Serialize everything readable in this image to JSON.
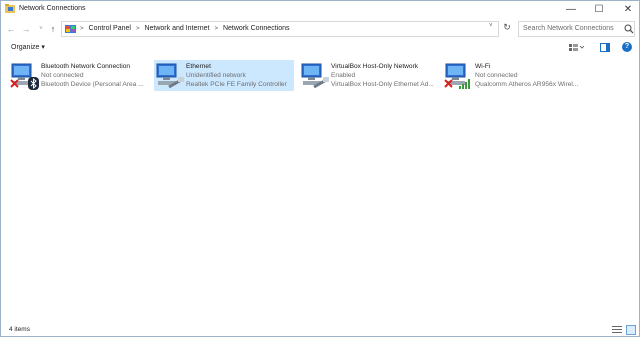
{
  "window": {
    "title": "Network Connections",
    "controls": {
      "minimize": "—",
      "maximize": "☐",
      "close": "✕"
    }
  },
  "nav": {
    "back": "←",
    "forward": "→",
    "recent": "˅",
    "up": "↑",
    "breadcrumbs": [
      "Control Panel",
      "Network and Internet",
      "Network Connections"
    ],
    "separator": ">",
    "dropdown": "˅",
    "refresh": "↻"
  },
  "search": {
    "placeholder": "Search Network Connections"
  },
  "toolbar": {
    "organize": "Organize ▾",
    "help": "?"
  },
  "items": [
    {
      "name": "Bluetooth Network Connection",
      "status": "Not connected",
      "device": "Bluetooth Device (Personal Area ...",
      "badge": "bluetooth-disconnected"
    },
    {
      "name": "Ethernet",
      "status": "Unidentified network",
      "device": "Realtek PCIe FE Family Controller",
      "badge": "ethernet",
      "selected": true
    },
    {
      "name": "VirtualBox Host-Only Network",
      "status": "Enabled",
      "device": "VirtualBox Host-Only Ethernet Ad...",
      "badge": "ethernet"
    },
    {
      "name": "Wi-Fi",
      "status": "Not connected",
      "device": "Qualcomm Atheros AR956x Wirel...",
      "badge": "wifi-disconnected"
    }
  ],
  "statusbar": {
    "count": "4 items"
  },
  "colors": {
    "selection": "#cce8ff",
    "accent": "#1a6fc7",
    "error": "#d9201f"
  }
}
